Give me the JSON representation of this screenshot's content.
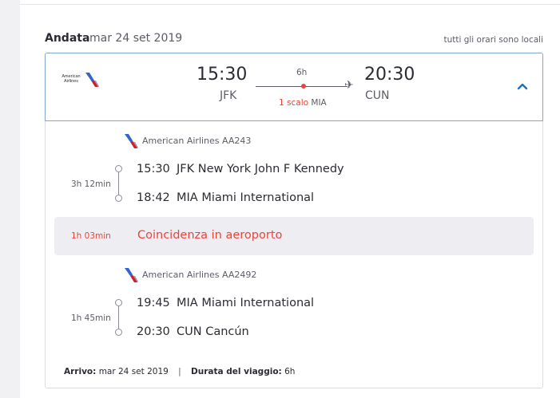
{
  "header": {
    "title": "Andata",
    "date": "mar 24 set 2019",
    "note": "tutti gli orari sono locali"
  },
  "summary": {
    "airline_logo_text": "American Airlines",
    "dep_time": "15:30",
    "dep_code": "JFK",
    "arr_time": "20:30",
    "arr_code": "CUN",
    "duration": "6h",
    "stops": "1 scalo",
    "stop_city": "MIA"
  },
  "segments": [
    {
      "carrier": "American Airlines AA243",
      "duration": "3h 12min",
      "dep_time": "15:30",
      "dep_place": "JFK New York John F Kennedy",
      "arr_time": "18:42",
      "arr_place": "MIA Miami International"
    },
    {
      "carrier": "American Airlines AA2492",
      "duration": "1h 45min",
      "dep_time": "19:45",
      "dep_place": "MIA Miami International",
      "arr_time": "20:30",
      "arr_place": "CUN Cancún"
    }
  ],
  "layover": {
    "duration": "1h 03min",
    "text": "Coincidenza in aeroporto"
  },
  "footer": {
    "arrival_label": "Arrivo:",
    "arrival_value": "mar 24 set 2019",
    "separator": "|",
    "duration_label": "Durata del viaggio:",
    "duration_value": "6h"
  },
  "icons": {
    "airline": "american-airlines-logo",
    "plane": "plane-icon",
    "expand": "chevron-up-icon"
  },
  "colors": {
    "accent": "#1a6fc2",
    "alert": "#e8453c",
    "selected_border": "#7fa7d2"
  }
}
